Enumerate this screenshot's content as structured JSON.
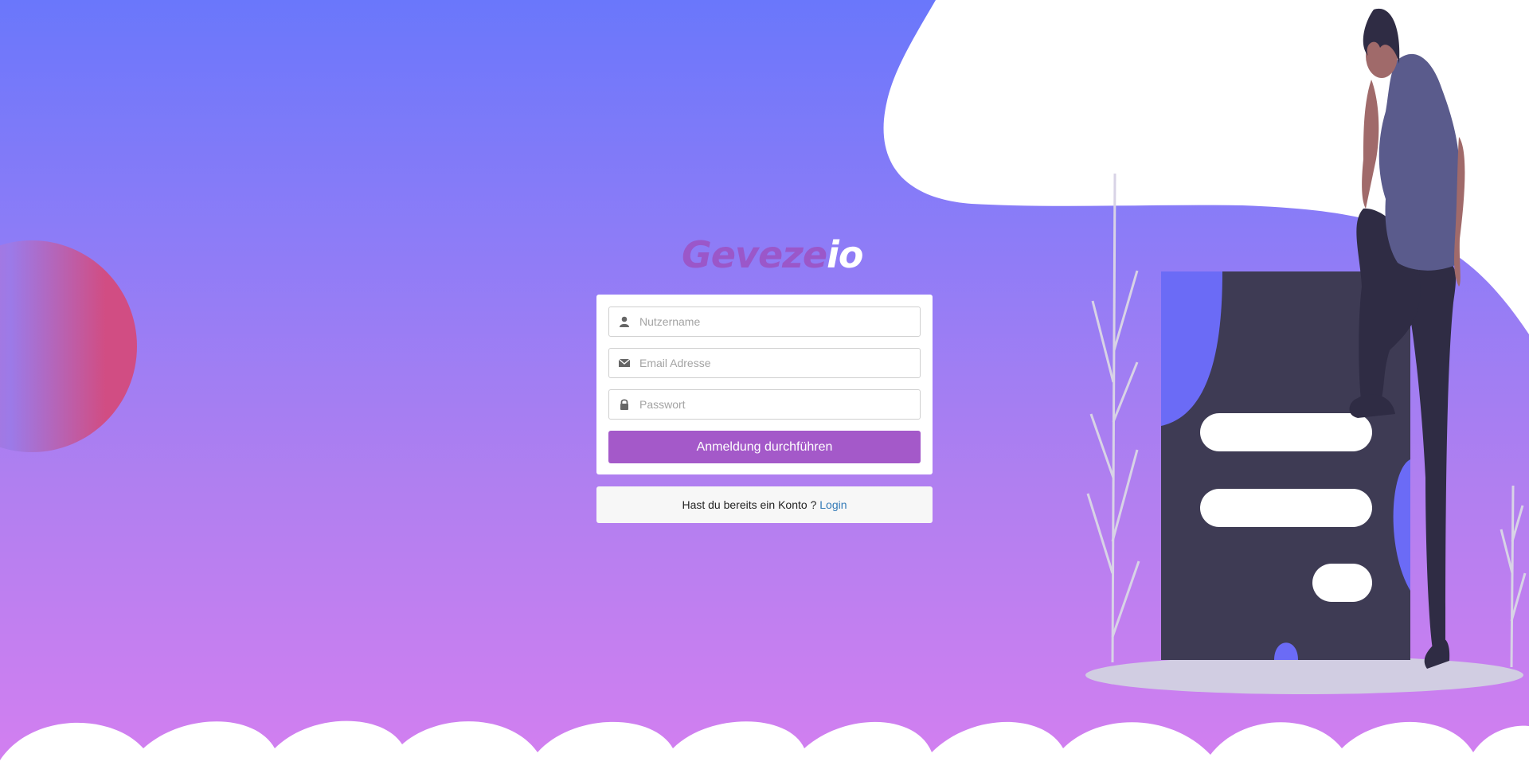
{
  "brand": {
    "logo_main": "Geveze",
    "logo_sub": "io",
    "accent": "#a459c9"
  },
  "form": {
    "username": {
      "placeholder": "Nutzername",
      "value": "",
      "icon": "user-icon"
    },
    "email": {
      "placeholder": "Email Adresse",
      "value": "",
      "icon": "envelope-icon"
    },
    "password": {
      "placeholder": "Passwort",
      "value": "",
      "icon": "lock-icon"
    },
    "submit_label": "Anmeldung durchführen"
  },
  "footer": {
    "prompt": "Hast du bereits ein Konto ?",
    "login_link": "Login",
    "link_color": "#337ab7"
  }
}
